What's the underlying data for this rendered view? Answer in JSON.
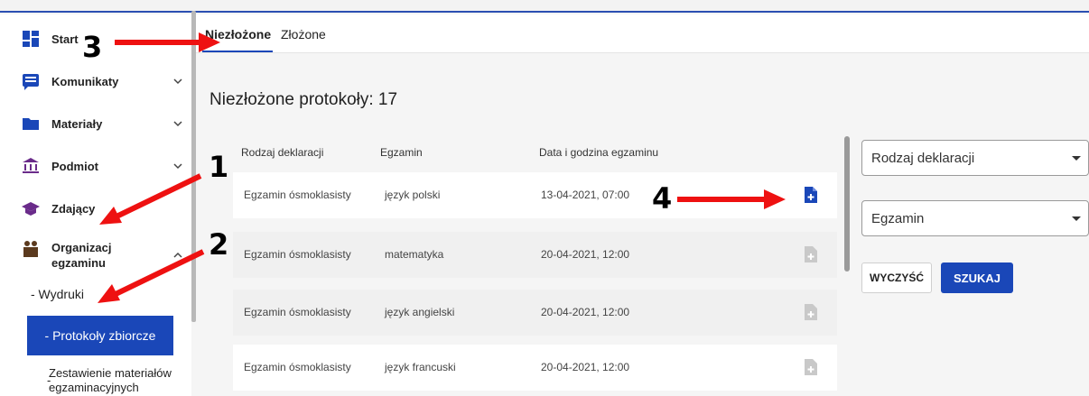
{
  "sidebar": {
    "items": [
      {
        "label": "Start",
        "icon": "dashboard-icon"
      },
      {
        "label": "Komunikaty",
        "icon": "message-icon"
      },
      {
        "label": "Materiały",
        "icon": "folder-icon"
      },
      {
        "label": "Podmiot",
        "icon": "institution-icon"
      },
      {
        "label": "Zdający",
        "icon": "graduation-cap-icon"
      },
      {
        "label_line1": "Organizacj",
        "label_line2": "egzaminu",
        "icon": "organization-icon"
      }
    ],
    "subitems": {
      "wydruki": "- Wydruki",
      "protokoly": "- Protokoły zbiorcze",
      "zestawienie_line1": "Zestawienie materiałów",
      "zestawienie_line2": "egzaminacyjnych",
      "zestawienie_dash": "-"
    },
    "active_color": "#1a47b8"
  },
  "tabs": [
    {
      "label": "Niezłożone",
      "active": true
    },
    {
      "label": "Złożone",
      "active": false
    }
  ],
  "main": {
    "heading": "Niezłożone protokoły: 17",
    "columns": [
      "Rodzaj deklaracji",
      "Egzamin",
      "Data i godzina egzaminu"
    ],
    "rows": [
      {
        "type": "Egzamin ósmoklasisty",
        "exam": "język polski",
        "date": "13-04-2021, 07:00",
        "action_enabled": true
      },
      {
        "type": "Egzamin ósmoklasisty",
        "exam": "matematyka",
        "date": "20-04-2021, 12:00",
        "action_enabled": false
      },
      {
        "type": "Egzamin ósmoklasisty",
        "exam": "język angielski",
        "date": "20-04-2021, 12:00",
        "action_enabled": false
      },
      {
        "type": "Egzamin ósmoklasisty",
        "exam": "język francuski",
        "date": "20-04-2021, 12:00",
        "action_enabled": false
      }
    ]
  },
  "filters": {
    "declaration_placeholder": "Rodzaj deklaracji",
    "exam_placeholder": "Egzamin",
    "clear_label": "WYCZYŚĆ",
    "search_label": "SZUKAJ"
  },
  "annotations": [
    "1",
    "2",
    "3",
    "4"
  ],
  "colors": {
    "primary": "#1a47b8",
    "arrow": "#ee1111"
  }
}
